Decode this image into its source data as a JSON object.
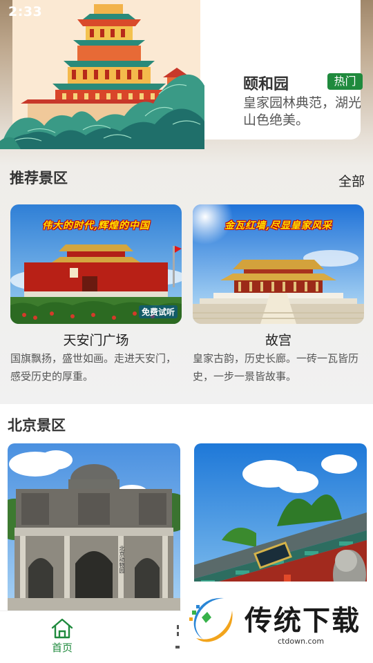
{
  "status_bar": {
    "time": "2:33"
  },
  "hero": {
    "title": "颐和园",
    "badge": "热门",
    "description": "皇家园林典范，湖光山色绝美。"
  },
  "recommended": {
    "title": "推荐景区",
    "see_all": "全部",
    "items": [
      {
        "name": "天安门广场",
        "banner": "伟大的时代,辉煌的中国",
        "badge": "免费试听",
        "description": "国旗飘扬，盛世如画。走进天安门，感受历史的厚重。"
      },
      {
        "name": "故宫",
        "banner": "金瓦红墙,尽显皇家风采",
        "description": "皇家古韵，历史长廊。一砖一瓦皆历史，一步一景皆故事。"
      }
    ]
  },
  "beijing": {
    "title": "北京景区",
    "gate_sign": "北京动物园"
  },
  "nav": {
    "home_label": "首页"
  },
  "watermark": {
    "logo_text": "传统下载",
    "domain": "ctdown.com"
  },
  "colors": {
    "accent_green": "#1f8a3d",
    "badge_yellow": "#ffe000",
    "banner_red": "#c0000a"
  }
}
